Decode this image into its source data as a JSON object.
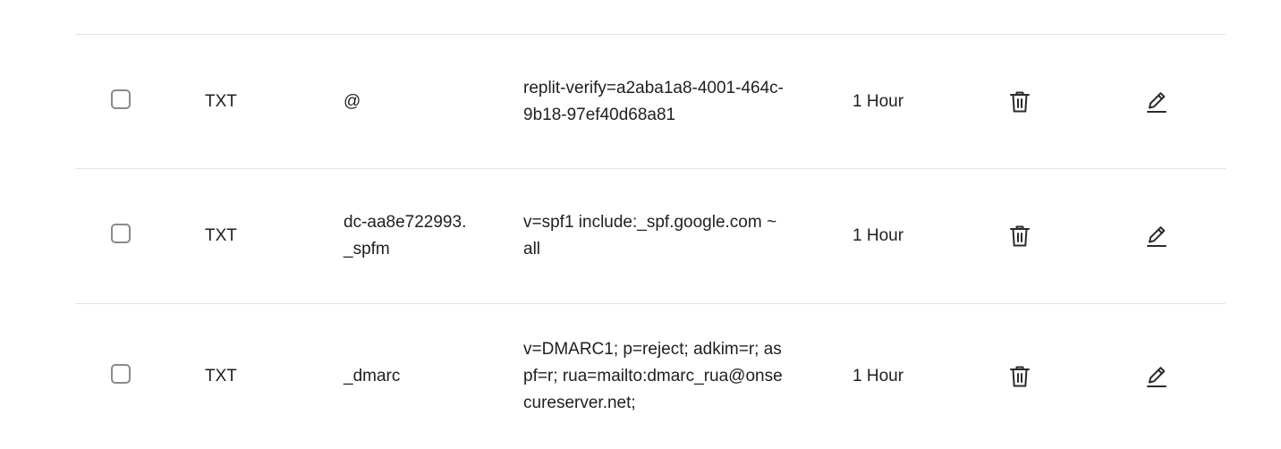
{
  "records": [
    {
      "type": "TXT",
      "name": "@",
      "value": "replit-verify=a2aba1a8-4001-464c-9b18-97ef40d68a81",
      "ttl": "1 Hour",
      "delete_icon": "trash-icon",
      "edit_icon": "pencil-icon"
    },
    {
      "type": "TXT",
      "name": "dc-aa8e722993._spfm",
      "value": "v=spf1 include:_spf.google.com ~all",
      "ttl": "1 Hour",
      "delete_icon": "trash-icon",
      "edit_icon": "pencil-icon"
    },
    {
      "type": "TXT",
      "name": "_dmarc",
      "value": "v=DMARC1; p=reject; adkim=r; aspf=r; rua=mailto:dmarc_rua@onsecureserver.net;",
      "ttl": "1 Hour",
      "delete_icon": "trash-icon",
      "edit_icon": "pencil-icon"
    }
  ],
  "colors": {
    "text": "#1f1f1f",
    "divider": "#e2e2e2",
    "checkbox_border": "#8a8a8a",
    "icon": "#2b2b2b"
  }
}
